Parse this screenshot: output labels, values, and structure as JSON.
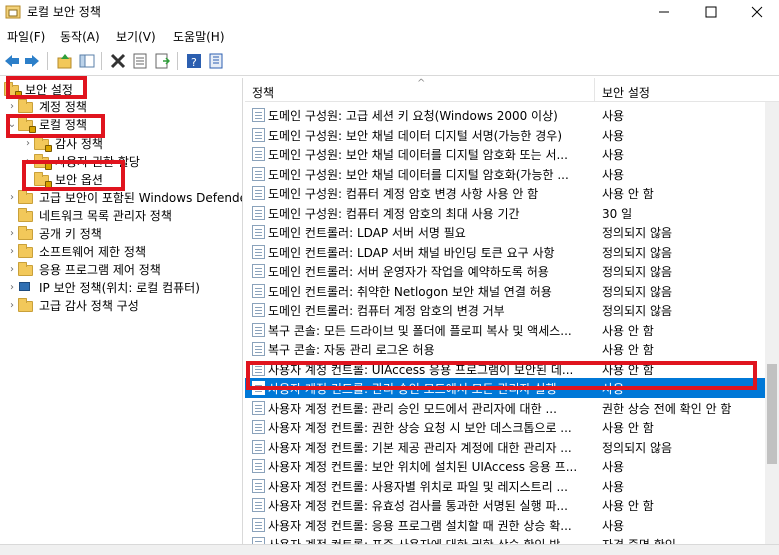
{
  "window": {
    "title": "로컬 보안 정책"
  },
  "menu": [
    "파일(F)",
    "동작(A)",
    "보기(V)",
    "도움말(H)"
  ],
  "tree": [
    {
      "label": "보안 설정",
      "arrow": ""
    },
    {
      "label": "계정 정책",
      "arrow": "›"
    },
    {
      "label": "로컬 정책",
      "arrow": "⌄"
    },
    {
      "label": "감사 정책",
      "arrow": "›"
    },
    {
      "label": "사용자 권한 할당",
      "arrow": "›"
    },
    {
      "label": "보안 옵션",
      "arrow": ""
    },
    {
      "label": "고급 보안이 포함된 Windows Defender",
      "arrow": "›"
    },
    {
      "label": "네트워크 목록 관리자 정책",
      "arrow": ""
    },
    {
      "label": "공개 키 정책",
      "arrow": "›"
    },
    {
      "label": "소프트웨어 제한 정책",
      "arrow": "›"
    },
    {
      "label": "응용 프로그램 제어 정책",
      "arrow": "›"
    },
    {
      "label": "IP 보안 정책(위치: 로컬 컴퓨터)",
      "arrow": "›"
    },
    {
      "label": "고급 감사 정책 구성",
      "arrow": "›"
    }
  ],
  "list": {
    "columns": {
      "policy": "정책",
      "setting": "보안 설정"
    },
    "rows": [
      {
        "name": "도메인 구성원: 고급 세션 키 요청(Windows 2000 이상)",
        "value": "사용"
      },
      {
        "name": "도메인 구성원: 보안 채널 데이터 디지털 서명(가능한 경우)",
        "value": "사용"
      },
      {
        "name": "도메인 구성원: 보안 채널 데이터를 디지털 암호화 또는 서...",
        "value": "사용"
      },
      {
        "name": "도메인 구성원: 보안 채널 데이터를 디지털 암호화(가능한 ...",
        "value": "사용"
      },
      {
        "name": "도메인 구성원: 컴퓨터 계정 암호 변경 사항 사용 안 함",
        "value": "사용 안 함"
      },
      {
        "name": "도메인 구성원: 컴퓨터 계정 암호의 최대 사용 기간",
        "value": "30 일"
      },
      {
        "name": "도메인 컨트롤러: LDAP 서버 서명 필요",
        "value": "정의되지 않음"
      },
      {
        "name": "도메인 컨트롤러: LDAP 서버 채널 바인딩 토큰 요구 사항",
        "value": "정의되지 않음"
      },
      {
        "name": "도메인 컨트롤러: 서버 운영자가 작업을 예약하도록 허용",
        "value": "정의되지 않음"
      },
      {
        "name": "도메인 컨트롤러: 취약한 Netlogon 보안 채널 연결 허용",
        "value": "정의되지 않음"
      },
      {
        "name": "도메인 컨트롤러: 컴퓨터 계정 암호의 변경 거부",
        "value": "정의되지 않음"
      },
      {
        "name": "복구 콘솔: 모든 드라이브 및 폴더에 플로피 복사 및 액세스...",
        "value": "사용 안 함"
      },
      {
        "name": "복구 콘솔: 자동 관리 로그온 허용",
        "value": "사용 안 함"
      },
      {
        "name": "사용자 계정 컨트롤: UIAccess 응용 프로그램이 보안된 데...",
        "value": "사용 안 함"
      },
      {
        "name": "사용자 계정 컨트롤: 관리 승인 모드에서 모든 관리자 실행",
        "value": "사용"
      },
      {
        "name": "사용자 계정 컨트롤: 관리 승인 모드에서 관리자에 대한 ...",
        "value": "권한 상승 전에 확인 안 함"
      },
      {
        "name": "사용자 계정 컨트롤: 권한 상승 요청 시 보안 데스크톱으로 ...",
        "value": "사용 안 함"
      },
      {
        "name": "사용자 계정 컨트롤: 기본 제공 관리자 계정에 대한 관리자 ...",
        "value": "정의되지 않음"
      },
      {
        "name": "사용자 계정 컨트롤: 보안 위치에 설치된 UIAccess 응용 프...",
        "value": "사용"
      },
      {
        "name": "사용자 계정 컨트롤: 사용자별 위치로 파일 및 레지스트리 ...",
        "value": "사용"
      },
      {
        "name": "사용자 계정 컨트롤: 유효성 검사를 통과한 서명된 실행 파...",
        "value": "사용 안 함"
      },
      {
        "name": "사용자 계정 컨트롤: 응용 프로그램 설치할 때 권한 상승 확...",
        "value": "사용"
      },
      {
        "name": "사용자 계정 컨트롤: 표준 사용자에 대한 권한 상승 확인 방...",
        "value": "자격 증명 확인"
      }
    ],
    "selected_index": 14
  },
  "colors": {
    "selection": "#0078d7",
    "highlight": "#e0141e"
  },
  "icons": [
    "window-icon",
    "minimize-icon",
    "maximize-icon",
    "close-icon",
    "back-icon",
    "forward-icon",
    "up-icon",
    "show-hide-tree-icon",
    "delete-icon",
    "properties-icon",
    "export-icon",
    "help-icon",
    "help-book-icon",
    "folder-icon",
    "lock-folder-icon",
    "computer-icon",
    "policy-icon"
  ]
}
